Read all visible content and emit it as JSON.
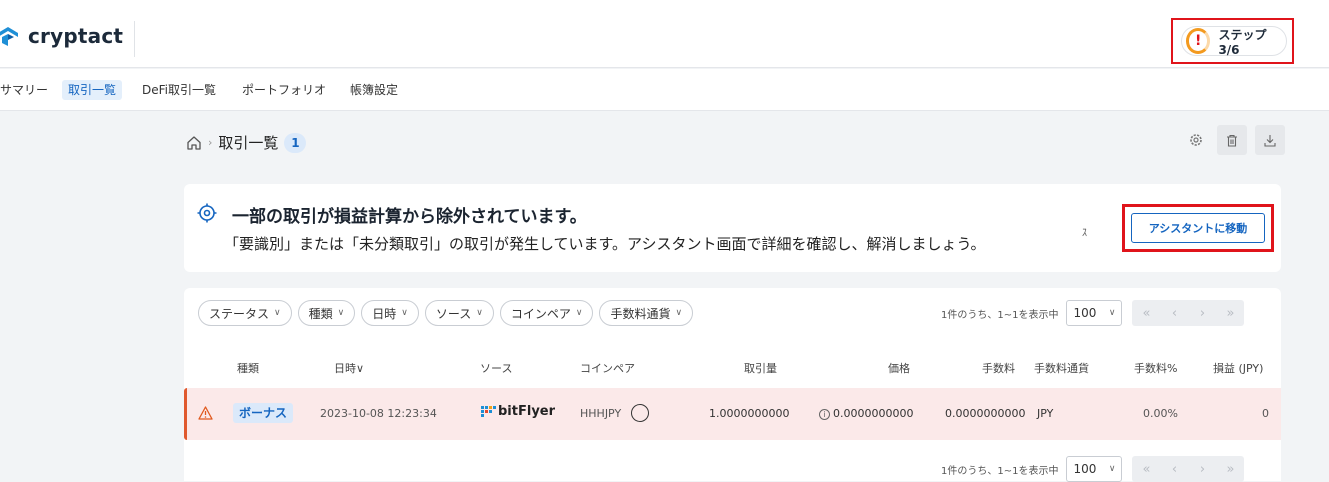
{
  "header": {
    "logo_text": "cryptact",
    "step_label": "ステップ 3/6",
    "step_icon": "!"
  },
  "nav": {
    "items": [
      "サマリー",
      "取引一覧",
      "DeFi取引一覧",
      "ポートフォリオ",
      "帳簿設定"
    ],
    "active_index": 1
  },
  "breadcrumb": {
    "title": "取引一覧",
    "count": "1",
    "separator": "›"
  },
  "alert": {
    "title": "一部の取引が損益計算から除外されています。",
    "message": "「要識別」または「未分類取引」の取引が発生しています。アシスタント画面で詳細を確認し、解消しましょう。",
    "stray_char": "ｽ",
    "button_label": "アシスタントに移動"
  },
  "filters": [
    "ステータス",
    "種類",
    "日時",
    "ソース",
    "コインペア",
    "手数料通貨"
  ],
  "pagination": {
    "summary": "1件のうち、1~1を表示中",
    "page_size": "100"
  },
  "table": {
    "headers": [
      "種類",
      "日時",
      "ソース",
      "コインペア",
      "取引量",
      "価格",
      "手数料",
      "手数料通貨",
      "手数料%",
      "損益 (JPY)"
    ],
    "date_sort_indicator": "∨",
    "rows": [
      {
        "type": "ボーナス",
        "date": "2023-10-08 12:23:34",
        "source": "bitFlyer",
        "pair": "HHHJPY",
        "amount": "1.0000000000",
        "price": "0.0000000000",
        "fee": "0.0000000000",
        "fee_currency": "JPY",
        "fee_pct": "0.00%",
        "pnl": "0"
      }
    ]
  },
  "colors": {
    "accent": "#1565c0",
    "highlight_border": "#e0141b",
    "warning_row": "#fbe9e9",
    "warning_bar": "#e0592e"
  }
}
